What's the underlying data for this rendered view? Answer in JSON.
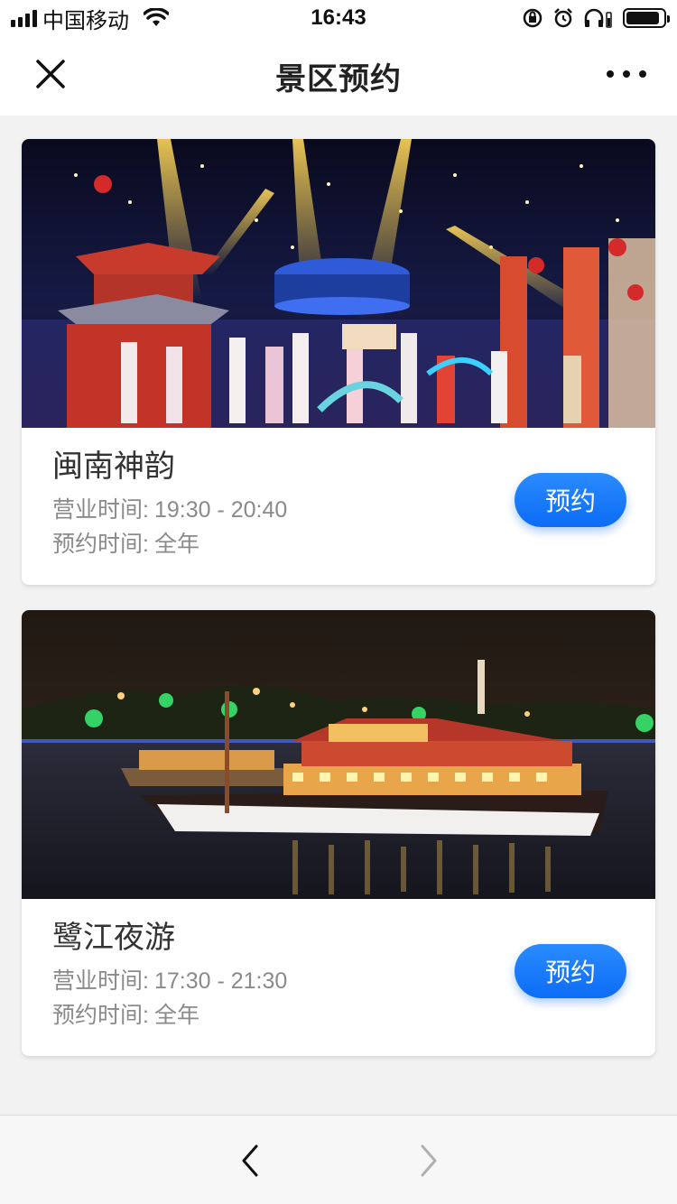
{
  "status_bar": {
    "carrier": "中国移动",
    "time": "16:43",
    "battery_level_fraction": 0.9
  },
  "header": {
    "title": "景区预约",
    "close_icon": "close-icon",
    "more_icon": "more-icon"
  },
  "venues": [
    {
      "name": "闽南神韵",
      "hours_label": "营业时间:",
      "hours_value": "19:30 - 20:40",
      "booking_label": "预约时间:",
      "booking_value": "全年",
      "button_label": "预约"
    },
    {
      "name": "鹭江夜游",
      "hours_label": "营业时间:",
      "hours_value": "17:30 - 21:30",
      "booking_label": "预约时间:",
      "booking_value": "全年",
      "button_label": "预约"
    }
  ],
  "toolbar": {
    "back_icon": "chevron-left-icon",
    "forward_icon": "chevron-right-icon"
  },
  "colors": {
    "accent": "#1677ff",
    "page_background": "#f2f2f2",
    "secondary_text": "#8a8a8a"
  }
}
